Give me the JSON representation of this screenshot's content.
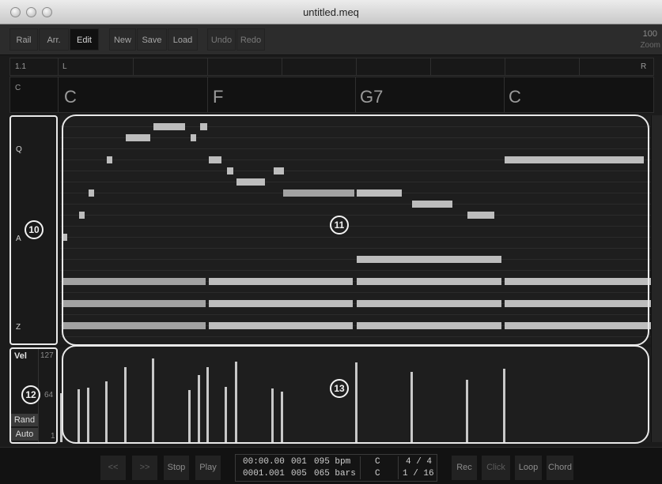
{
  "window": {
    "title": "untitled.meq"
  },
  "toolbar": {
    "buttons": [
      {
        "label": "Rail"
      },
      {
        "label": "Arr."
      },
      {
        "label": "Edit"
      },
      {
        "label": "New"
      },
      {
        "label": "Save"
      },
      {
        "label": "Load"
      },
      {
        "label": "Undo"
      },
      {
        "label": "Redo"
      }
    ],
    "zoom_value": "100",
    "zoom_label": "Zoom"
  },
  "ruler": {
    "position": "1.1",
    "left": "L",
    "right": "R"
  },
  "chord_track": {
    "key": "C",
    "chords": [
      "C",
      "F",
      "G7",
      "C"
    ]
  },
  "keyboard": {
    "labels": [
      "Q",
      "A",
      "Z"
    ]
  },
  "velocity": {
    "label": "Vel",
    "max": "127",
    "mid": "64",
    "min": "1",
    "rand_label": "Rand",
    "auto_label": "Auto"
  },
  "callouts": {
    "keys": "10",
    "roll": "11",
    "vel_panel": "12",
    "velocity": "13"
  },
  "transport": {
    "rewind": "<<",
    "forward": ">>",
    "stop": "Stop",
    "play": "Play",
    "time": "00:00.00",
    "pos": "0001.001",
    "n1": "001",
    "n2": "005",
    "bpm": "095 bpm",
    "bars": "065 bars",
    "key1": "C",
    "key2": "C",
    "sig": "4 / 4",
    "quant": "1 / 16",
    "rec": "Rec",
    "click": "Click",
    "loop": "Loop",
    "chord": "Chord"
  }
}
